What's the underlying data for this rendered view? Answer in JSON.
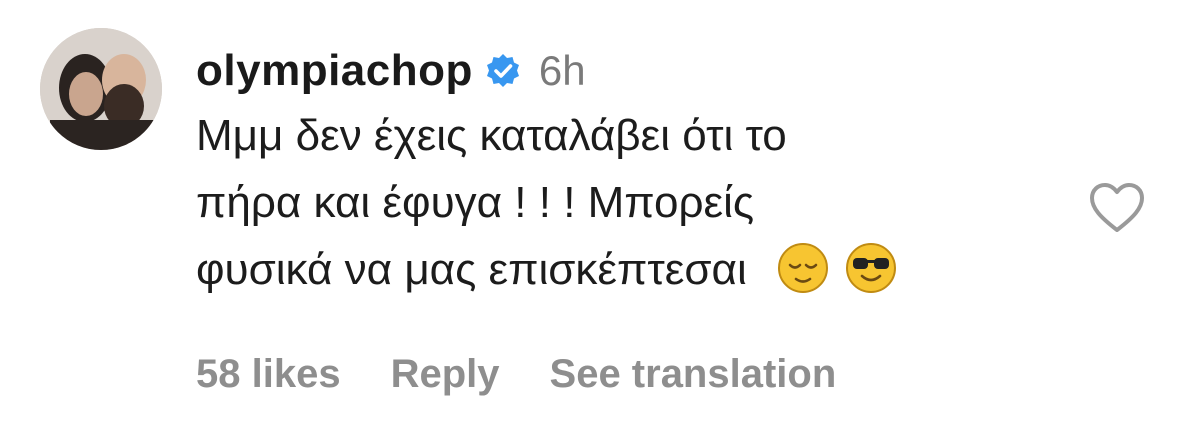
{
  "comment": {
    "username": "olympiachop",
    "time": "6h",
    "lines": [
      "Μμμ δεν έχεις καταλάβει ότι το",
      "πήρα και έφυγα ! ! ! Μπορείς",
      "φυσικά να μας επισκέπτεσαι"
    ],
    "emojis": [
      "relieved-face",
      "smiling-face-with-sunglasses"
    ]
  },
  "actions": {
    "likes": "58 likes",
    "reply": "Reply",
    "translation": "See translation"
  },
  "colors": {
    "verified": "#3897f0",
    "meta_text": "#8e8e8e",
    "emoji_yellow": "#f7c531"
  },
  "icons": {
    "verified": "verified-badge-icon",
    "like": "heart-outline-icon"
  }
}
